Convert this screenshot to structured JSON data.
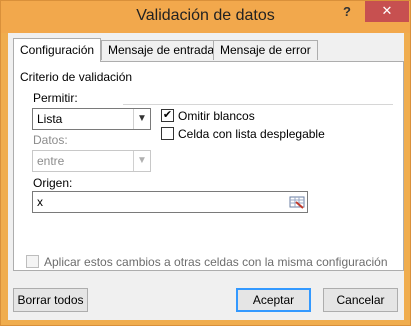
{
  "window": {
    "title": "Validación de datos",
    "help_label": "?",
    "close_label": "✕"
  },
  "tabs": [
    {
      "label": "Configuración"
    },
    {
      "label": "Mensaje de entrada"
    },
    {
      "label": "Mensaje de error"
    }
  ],
  "config": {
    "section_title": "Criterio de validación",
    "permitir_label": "Permitir:",
    "permitir_value": "Lista",
    "datos_label": "Datos:",
    "datos_value": "entre",
    "omitir_label": "Omitir blancos",
    "omitir_checked": true,
    "celda_label": "Celda con lista desplegable",
    "celda_checked": false,
    "origen_label": "Origen:",
    "origen_value": "x",
    "aplicar_label": "Aplicar estos cambios a otras celdas con la misma configuración"
  },
  "buttons": {
    "borrar": "Borrar todos",
    "aceptar": "Aceptar",
    "cancelar": "Cancelar"
  },
  "colors": {
    "titlebar": "#f2a84c",
    "close": "#c75050",
    "focus_border": "#3399ff"
  }
}
